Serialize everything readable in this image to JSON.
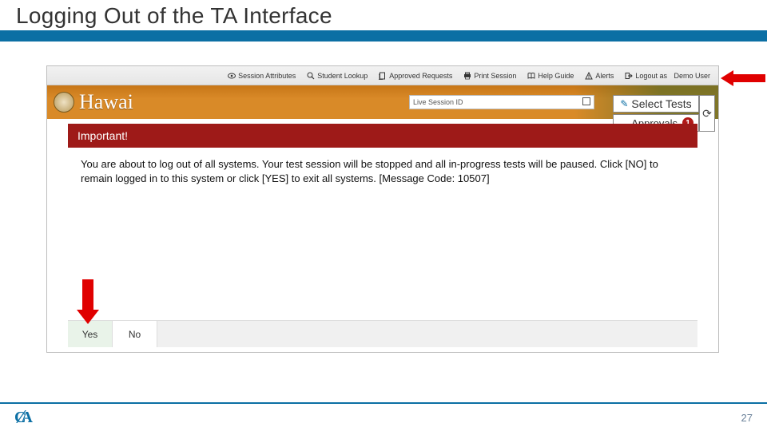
{
  "slide": {
    "heading": "Logging Out of the TA Interface",
    "page_number": "27"
  },
  "toolbar": {
    "items": [
      {
        "icon": "eye-icon",
        "label": "Session Attributes"
      },
      {
        "icon": "search-icon",
        "label": "Student Lookup"
      },
      {
        "icon": "doc-icon",
        "label": "Approved Requests"
      },
      {
        "icon": "printer-icon",
        "label": "Print Session"
      },
      {
        "icon": "book-icon",
        "label": "Help Guide"
      },
      {
        "icon": "alert-icon",
        "label": "Alerts"
      }
    ],
    "logout": {
      "icon": "logout-icon",
      "prefix": "Logout as",
      "user": "Demo User"
    }
  },
  "brand": {
    "name": "Hawai"
  },
  "session_box": {
    "label": "Live Session ID"
  },
  "panel": {
    "select_label": "Select Tests",
    "approvals_label": "Approvals",
    "approvals_count": "1",
    "refresh_glyph": "⟳"
  },
  "modal": {
    "title": "Important!",
    "body": "You are about to log out of all systems. Your test session will be stopped and all in-progress tests will be paused. Click [NO] to remain logged in to this system or click [YES] to exit all systems. [Message Code: 10507]",
    "yes": "Yes",
    "no": "No"
  },
  "logo": {
    "text_c": "C",
    "text_a": "A"
  }
}
